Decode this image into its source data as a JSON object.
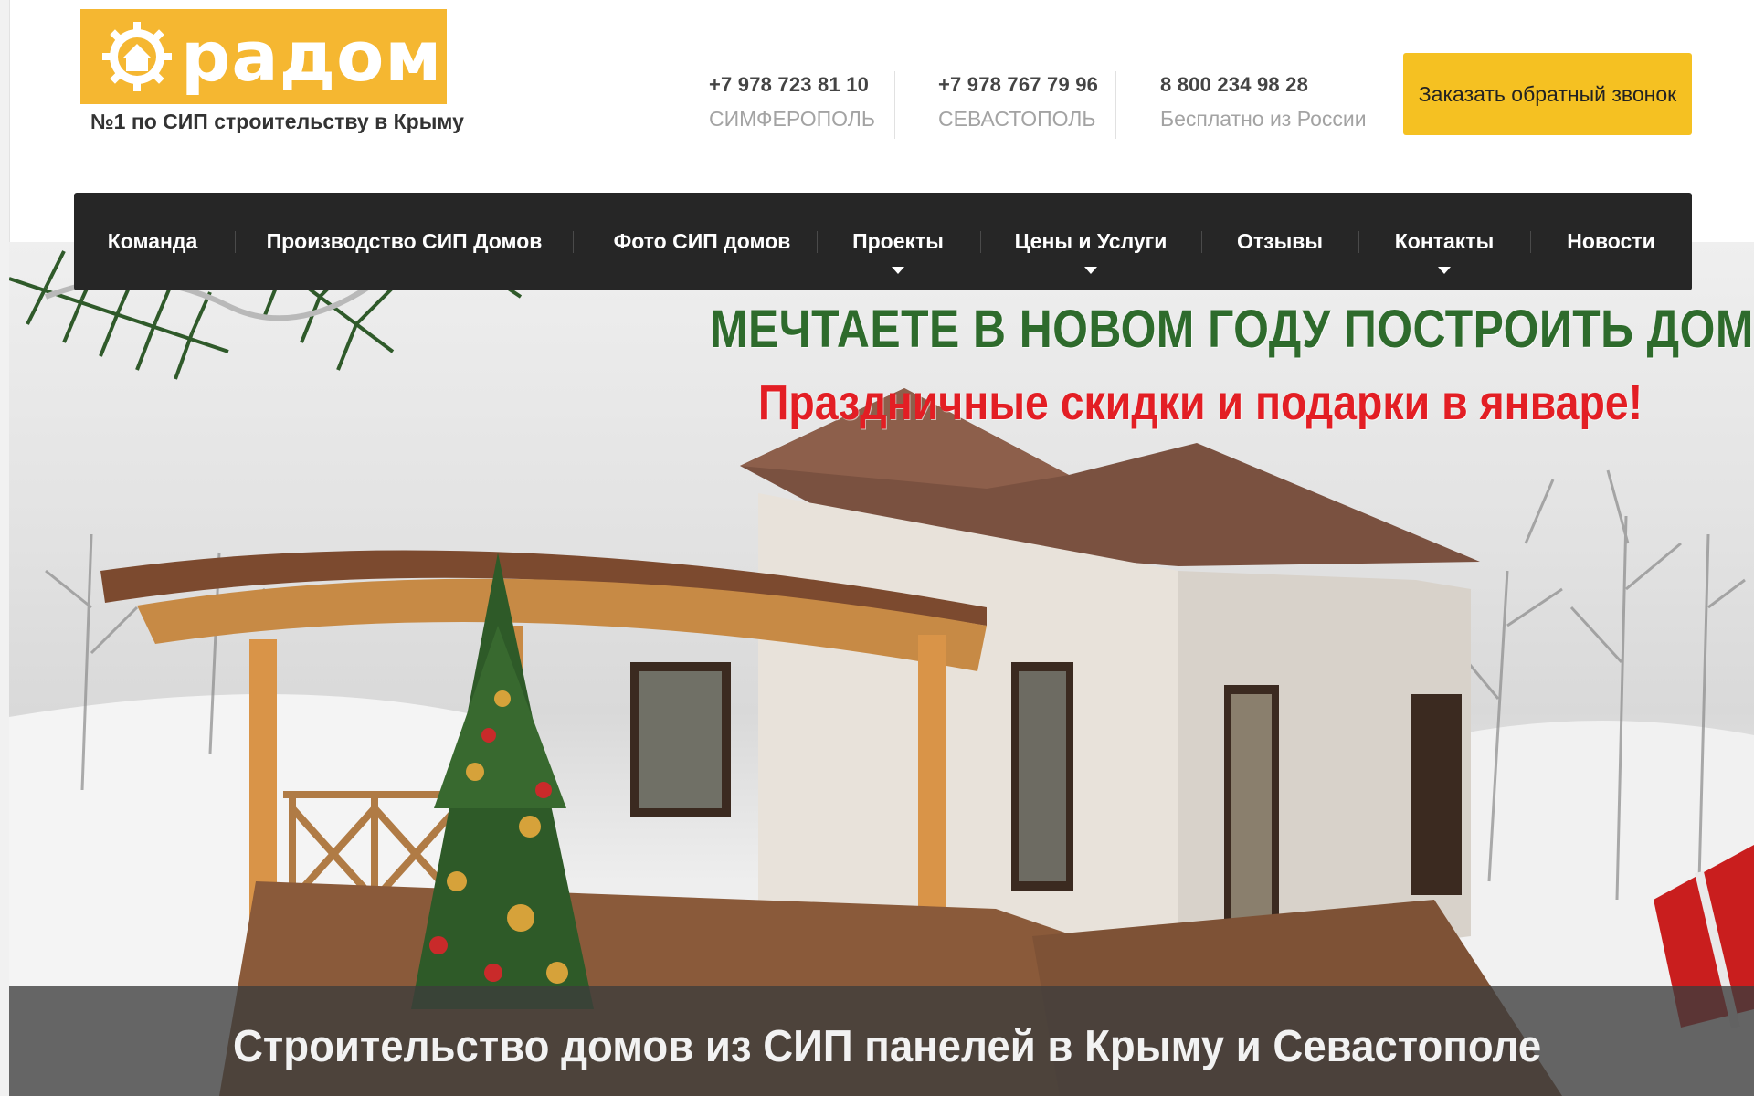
{
  "header": {
    "logo_text": "радом",
    "tagline": "№1 по СИП строительству в Крыму",
    "contacts": [
      {
        "phone": "+7 978 723 81 10",
        "city": "СИМФЕРОПОЛЬ"
      },
      {
        "phone": "+7 978 767 79 96",
        "city": "СЕВАСТОПОЛЬ"
      },
      {
        "phone": "8 800 234 98 28",
        "city": "Бесплатно из России"
      }
    ],
    "callback_label": "Заказать обратный звонок"
  },
  "nav": {
    "items": [
      {
        "label": "Команда"
      },
      {
        "label": "Производство СИП Домов"
      },
      {
        "label": "Фото СИП домов"
      },
      {
        "label": "Проекты",
        "has_dropdown": true
      },
      {
        "label": "Цены и Услуги",
        "has_dropdown": true
      },
      {
        "label": "Отзывы"
      },
      {
        "label": "Контакты",
        "has_dropdown": true
      },
      {
        "label": "Новости"
      }
    ]
  },
  "hero": {
    "promo_title": "МЕЧТАЕТЕ В НОВОМ ГОДУ ПОСТРОИТЬ ДОМ?",
    "promo_subtitle": "Праздничные скидки и подарки в январе!",
    "caption": "Строительство домов из СИП панелей в Крыму и Севастополе"
  },
  "colors": {
    "brand_yellow": "#f5b731",
    "button_yellow": "#f5c122",
    "nav_background": "#262626",
    "promo_green": "#2e6b2c",
    "promo_red": "#e31e24"
  },
  "icons": [
    "logo-gear-house-icon",
    "chevron-down-icon"
  ]
}
